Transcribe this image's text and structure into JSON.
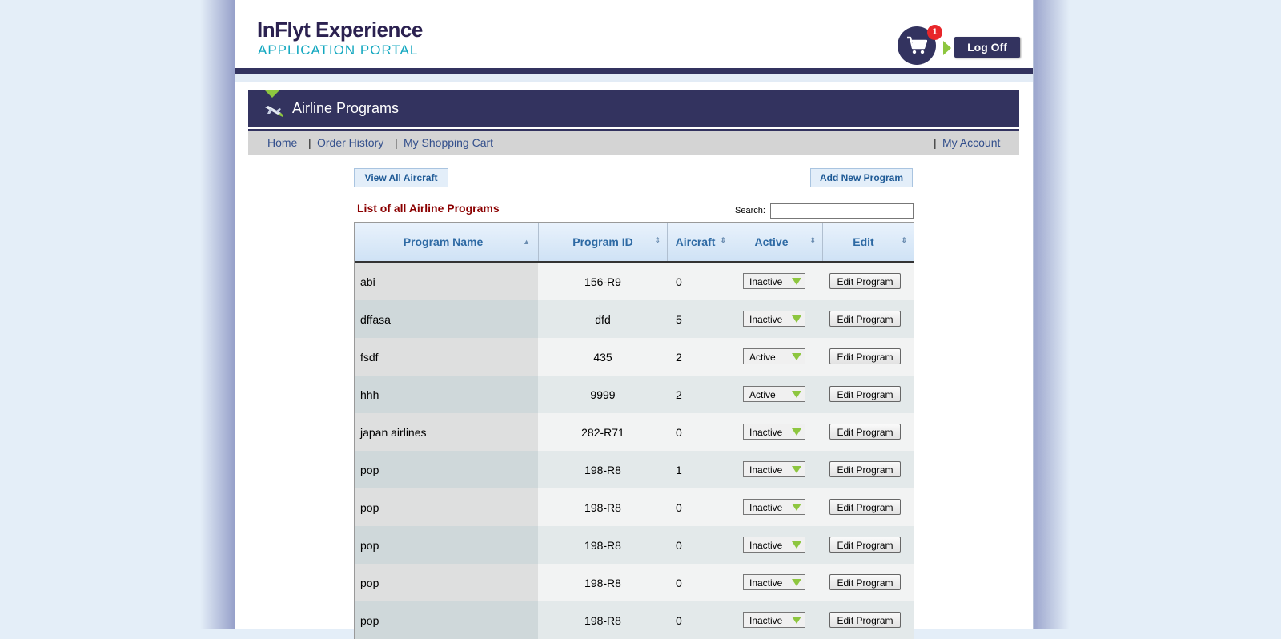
{
  "brand": {
    "title": "InFlyt Experience",
    "subtitle": "APPLICATION PORTAL"
  },
  "cart": {
    "count": "1"
  },
  "header": {
    "logoff_label": "Log Off"
  },
  "section": {
    "title": "Airline Programs"
  },
  "nav": {
    "home": "Home",
    "order_history": "Order History",
    "shopping_cart": "My Shopping Cart",
    "my_account": "My Account",
    "separator": "|"
  },
  "actions": {
    "view_all": "View All Aircraft",
    "add_new": "Add New Program"
  },
  "list": {
    "title": "List of all Airline Programs",
    "search_label": "Search:",
    "search_value": ""
  },
  "table": {
    "columns": [
      "Program Name",
      "Program ID",
      "Aircraft",
      "Active",
      "Edit"
    ],
    "edit_label": "Edit Program",
    "rows": [
      {
        "name": "abi",
        "id": "156-R9",
        "aircraft": "0",
        "status": "Inactive"
      },
      {
        "name": "dffasa",
        "id": "dfd",
        "aircraft": "5",
        "status": "Inactive"
      },
      {
        "name": "fsdf",
        "id": "435",
        "aircraft": "2",
        "status": "Active"
      },
      {
        "name": "hhh",
        "id": "9999",
        "aircraft": "2",
        "status": "Active"
      },
      {
        "name": "japan airlines",
        "id": "282-R71",
        "aircraft": "0",
        "status": "Inactive"
      },
      {
        "name": "pop",
        "id": "198-R8",
        "aircraft": "1",
        "status": "Inactive"
      },
      {
        "name": "pop",
        "id": "198-R8",
        "aircraft": "0",
        "status": "Inactive"
      },
      {
        "name": "pop",
        "id": "198-R8",
        "aircraft": "0",
        "status": "Inactive"
      },
      {
        "name": "pop",
        "id": "198-R8",
        "aircraft": "0",
        "status": "Inactive"
      },
      {
        "name": "pop",
        "id": "198-R8",
        "aircraft": "0",
        "status": "Inactive"
      }
    ]
  },
  "icons": {
    "cart": "shopping-cart-icon",
    "plane": "airplane-icon",
    "sort": "sort-icon"
  },
  "colors": {
    "navy": "#33335f",
    "accent_green": "#8dc63f",
    "badge_red": "#e8262a",
    "title_red": "#8b0000",
    "link_blue": "#334f8c"
  }
}
